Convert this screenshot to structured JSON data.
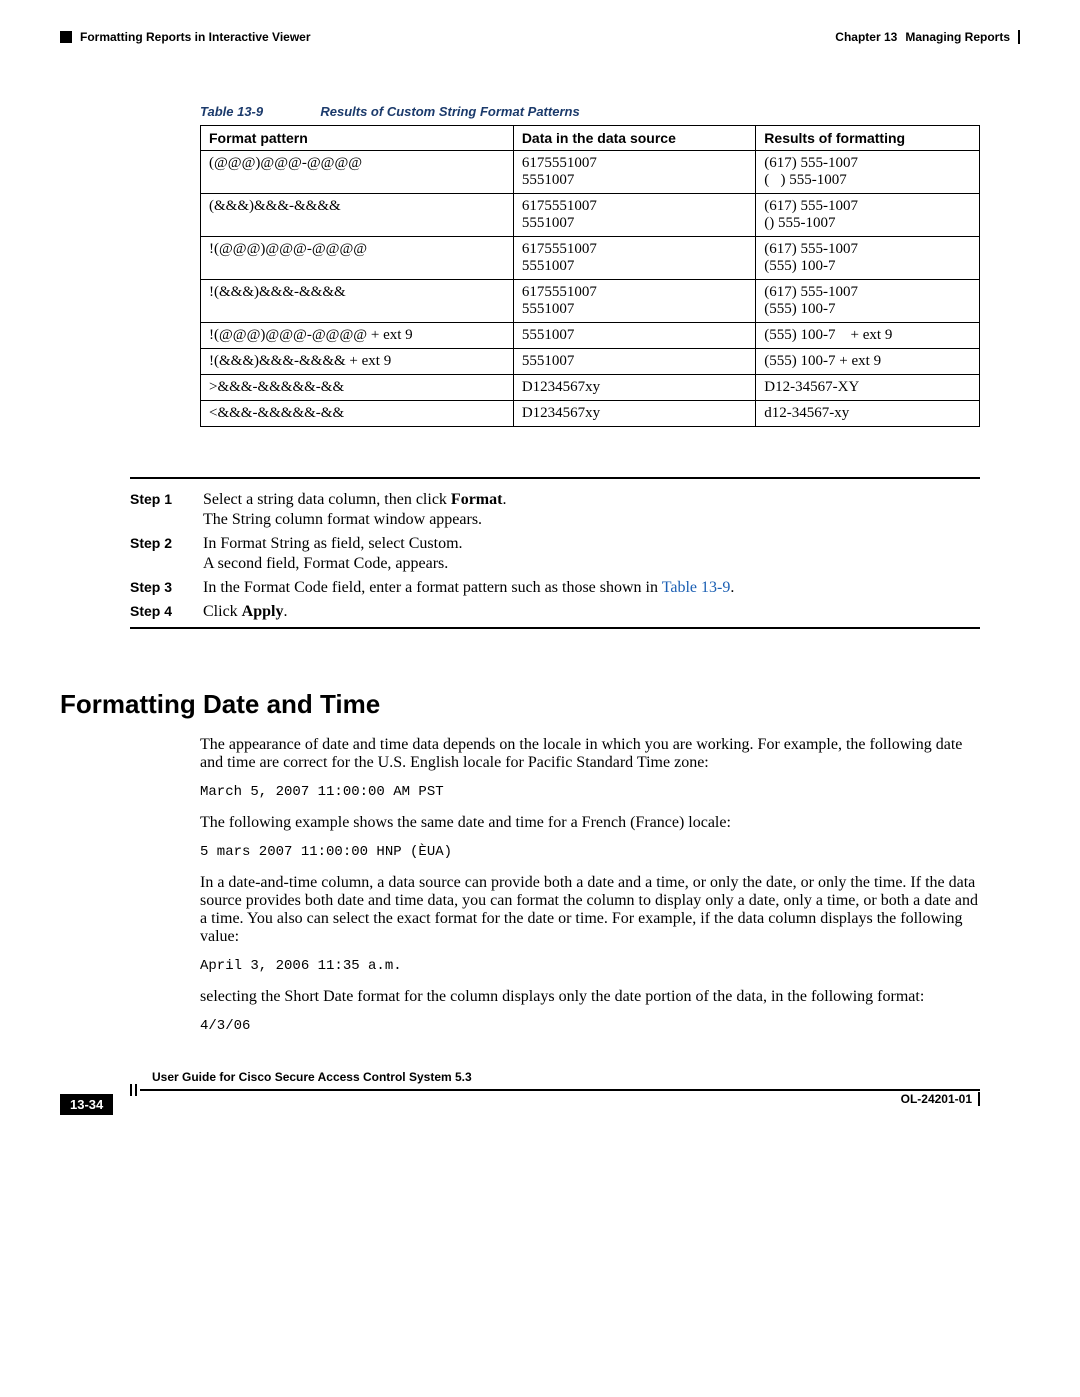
{
  "header": {
    "section_title": "Formatting Reports in Interactive Viewer",
    "chapter_label": "Chapter 13",
    "chapter_title": "Managing Reports"
  },
  "table": {
    "caption_label": "Table 13-9",
    "caption_title": "Results of Custom String Format Patterns",
    "columns": [
      "Format pattern",
      "Data in the data source",
      "Results of formatting"
    ],
    "rows": [
      {
        "pattern": "(@@@)@@@-@@@@",
        "data": "6175551007\n5551007",
        "result": "(617) 555-1007\n(   ) 555-1007"
      },
      {
        "pattern": "(&&&)&&&-&&&&",
        "data": "6175551007\n5551007",
        "result": "(617) 555-1007\n() 555-1007"
      },
      {
        "pattern": "!(@@@)@@@-@@@@",
        "data": "6175551007\n5551007",
        "result": "(617) 555-1007\n(555) 100-7"
      },
      {
        "pattern": "!(&&&)&&&-&&&&",
        "data": "6175551007\n5551007",
        "result": "(617) 555-1007\n(555) 100-7"
      },
      {
        "pattern": "!(@@@)@@@-@@@@ + ext 9",
        "data": "5551007",
        "result": "(555) 100-7    + ext 9"
      },
      {
        "pattern": "!(&&&)&&&-&&&& + ext 9",
        "data": "5551007",
        "result": "(555) 100-7 + ext 9"
      },
      {
        "pattern": ">&&&-&&&&&-&&",
        "data": "D1234567xy",
        "result": "D12-34567-XY"
      },
      {
        "pattern": "<&&&-&&&&&-&&",
        "data": "D1234567xy",
        "result": "d12-34567-xy"
      }
    ]
  },
  "steps": [
    {
      "label": "Step 1",
      "html": "Select a string data column, then click <strong>Format</strong>.<span class='sub'>The String column format window appears.</span>"
    },
    {
      "label": "Step 2",
      "html": "In Format String as field, select Custom.<span class='sub'>A second field, Format Code, appears.</span>"
    },
    {
      "label": "Step 3",
      "html": "In the Format Code field, enter a format pattern such as those shown in <a href='#'>Table 13-9</a>."
    },
    {
      "label": "Step 4",
      "html": "Click <strong>Apply</strong>."
    }
  ],
  "section_heading": "Formatting Date and Time",
  "body": {
    "p1": "The appearance of date and time data depends on the locale in which you are working. For example, the following date and time are correct for the U.S. English locale for Pacific Standard Time zone:",
    "code1": "March 5, 2007 11:00:00 AM PST",
    "p2": "The following example shows the same date and time for a French (France) locale:",
    "code2": "5 mars 2007 11:00:00 HNP (ÈUA)",
    "p3": "In a date-and-time column, a data source can provide both a date and a time, or only the date, or only the time. If the data source provides both date and time data, you can format the column to display only a date, only a time, or both a date and a time. You also can select the exact format for the date or time. For example, if the data column displays the following value:",
    "code3": "April 3, 2006 11:35 a.m.",
    "p4": "selecting the Short Date format for the column displays only the date portion of the data, in the following format:",
    "code4": "4/3/06"
  },
  "footer": {
    "guide_title": "User Guide for Cisco Secure Access Control System 5.3",
    "page_number": "13-34",
    "doc_id": "OL-24201-01"
  }
}
